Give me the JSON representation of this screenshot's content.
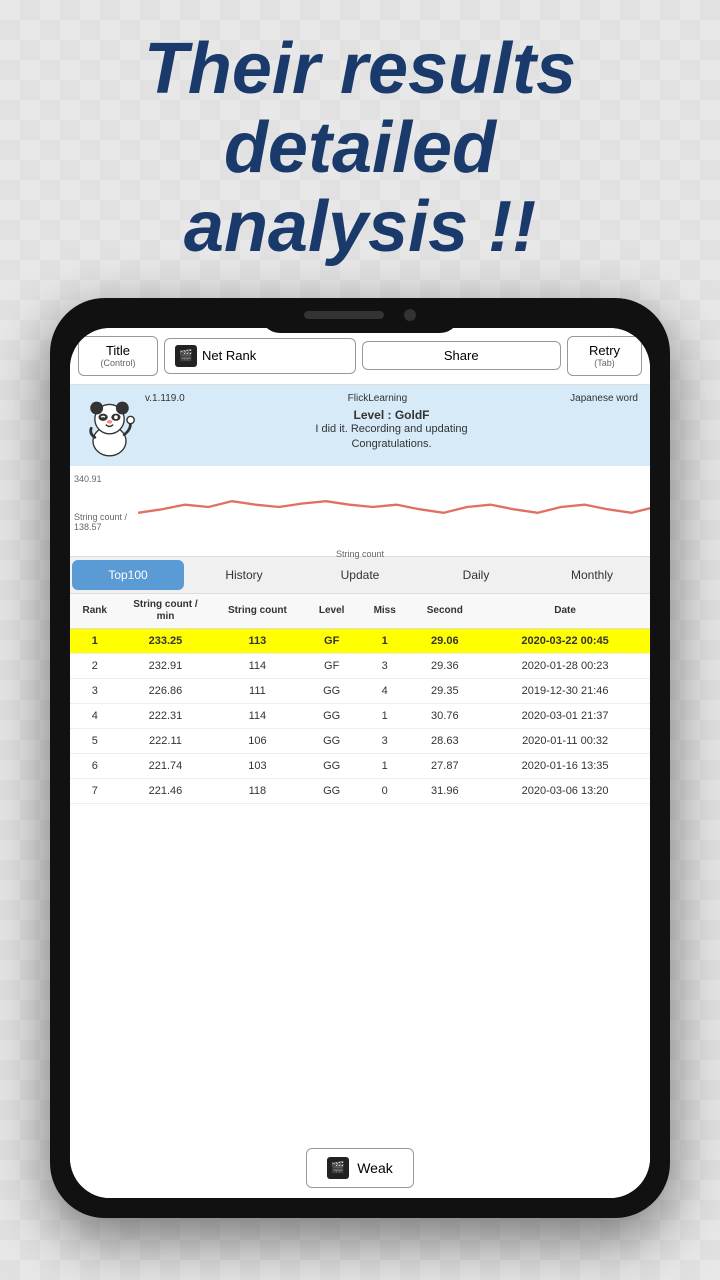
{
  "headline": {
    "line1": "Their results",
    "line2": "detailed",
    "line3": "analysis !!"
  },
  "toolbar": {
    "title_label": "Title",
    "title_sublabel": "(Control)",
    "netrank_icon": "🎬",
    "netrank_label": "Net Rank",
    "share_label": "Share",
    "retry_label": "Retry",
    "retry_sublabel": "(Tab)"
  },
  "info": {
    "version": "v.1.119.0",
    "app_name": "FlickLearning",
    "category": "Japanese word",
    "level_label": "Level : GoldF",
    "message": "I did it. Recording and updating\nCongratulations."
  },
  "chart": {
    "y_max": "340.91",
    "y_label": "String count /",
    "y_min": "138.57",
    "x_label": "String count"
  },
  "tabs": [
    {
      "id": "top100",
      "label": "Top100",
      "active": true
    },
    {
      "id": "history",
      "label": "History",
      "active": false
    },
    {
      "id": "update",
      "label": "Update",
      "active": false
    },
    {
      "id": "daily",
      "label": "Daily",
      "active": false
    },
    {
      "id": "monthly",
      "label": "Monthly",
      "active": false
    }
  ],
  "table": {
    "headers": {
      "rank": "Rank",
      "string_count_min": "String count / min",
      "string_count": "String count",
      "level": "Level",
      "miss": "Miss",
      "second": "Second",
      "date": "Date"
    },
    "rows": [
      {
        "rank": "1",
        "sc_min": "233.25",
        "sc": "113",
        "level": "GF",
        "miss": "1",
        "second": "29.06",
        "date": "2020-03-22 00:45",
        "highlight": true
      },
      {
        "rank": "2",
        "sc_min": "232.91",
        "sc": "114",
        "level": "GF",
        "miss": "3",
        "second": "29.36",
        "date": "2020-01-28 00:23",
        "highlight": false
      },
      {
        "rank": "3",
        "sc_min": "226.86",
        "sc": "111",
        "level": "GG",
        "miss": "4",
        "second": "29.35",
        "date": "2019-12-30 21:46",
        "highlight": false
      },
      {
        "rank": "4",
        "sc_min": "222.31",
        "sc": "114",
        "level": "GG",
        "miss": "1",
        "second": "30.76",
        "date": "2020-03-01 21:37",
        "highlight": false
      },
      {
        "rank": "5",
        "sc_min": "222.11",
        "sc": "106",
        "level": "GG",
        "miss": "3",
        "second": "28.63",
        "date": "2020-01-11 00:32",
        "highlight": false
      },
      {
        "rank": "6",
        "sc_min": "221.74",
        "sc": "103",
        "level": "GG",
        "miss": "1",
        "second": "27.87",
        "date": "2020-01-16 13:35",
        "highlight": false
      },
      {
        "rank": "7",
        "sc_min": "221.46",
        "sc": "118",
        "level": "GG",
        "miss": "0",
        "second": "31.96",
        "date": "2020-03-06 13:20",
        "highlight": false
      }
    ]
  },
  "weak_button": {
    "icon": "🎬",
    "label": "Weak"
  }
}
